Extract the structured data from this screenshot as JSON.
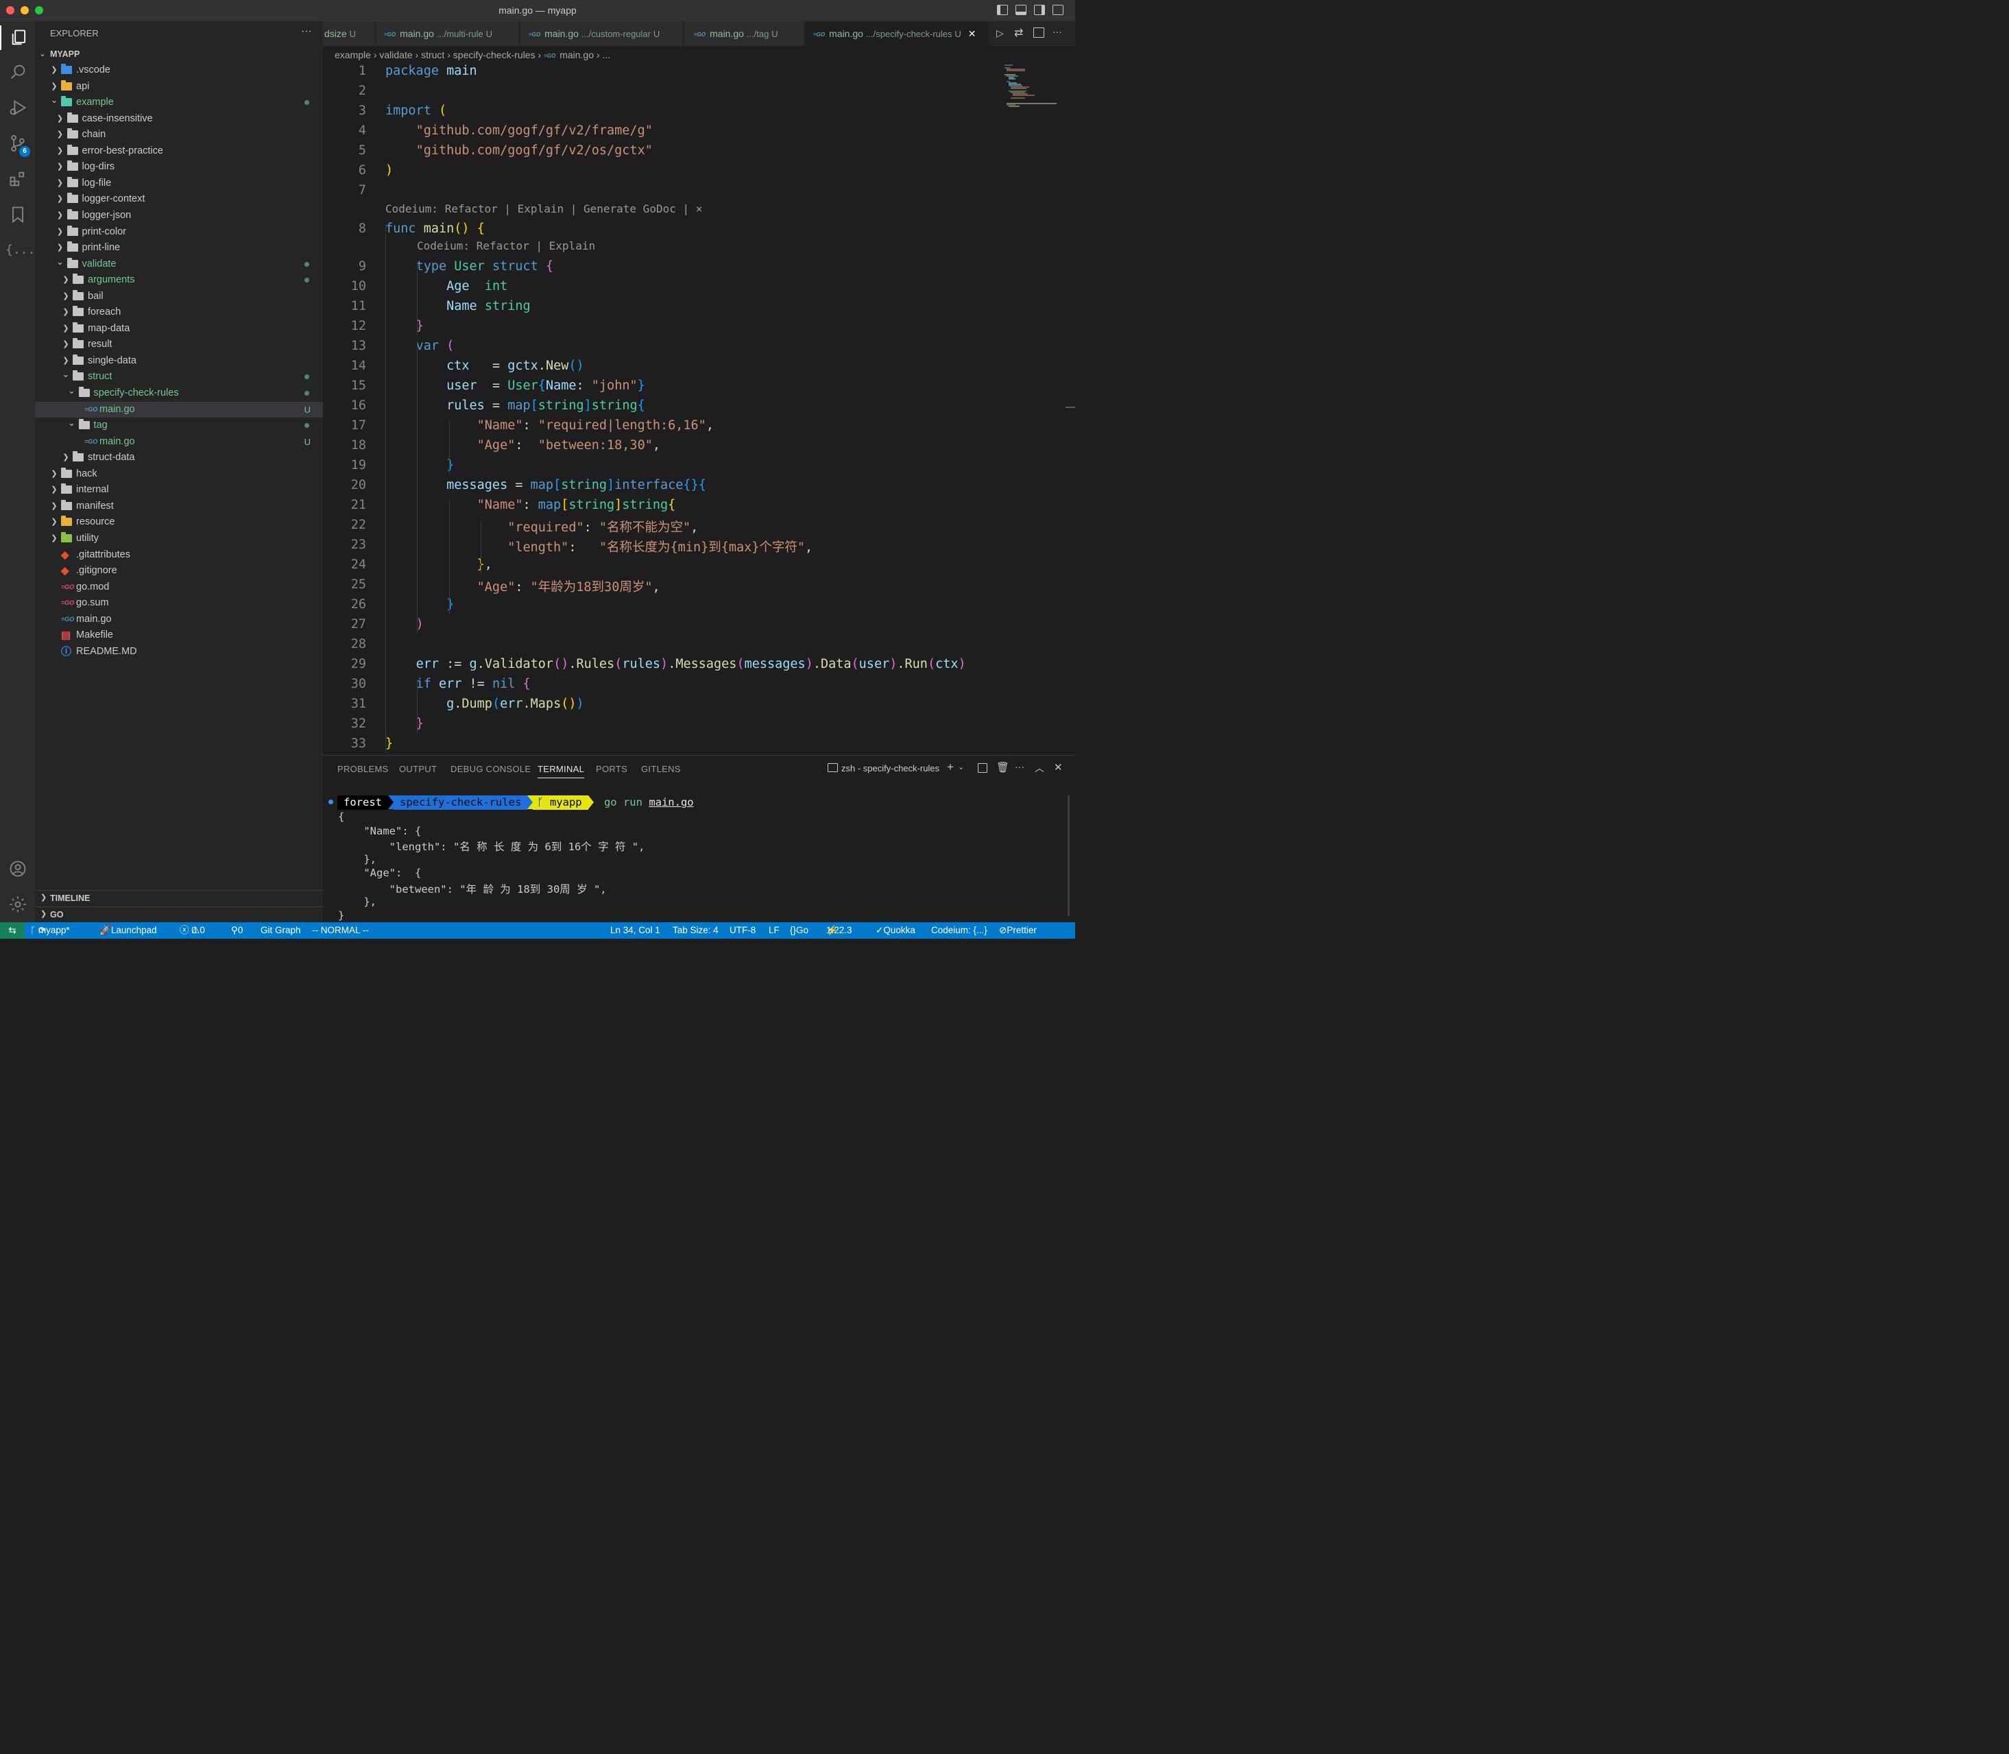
{
  "window": {
    "title": "main.go — myapp"
  },
  "explorer": {
    "header": "EXPLORER",
    "more": "···",
    "root": "MYAPP",
    "items": [
      {
        "label": ".vscode",
        "depth": 0,
        "kind": "folder-vscode",
        "open": false
      },
      {
        "label": "api",
        "depth": 0,
        "kind": "folder-yellow",
        "open": false
      },
      {
        "label": "example",
        "depth": 0,
        "kind": "folder-teal",
        "open": true,
        "dot": true,
        "green": true
      },
      {
        "label": "case-insensitive",
        "depth": 1,
        "kind": "folder",
        "open": false
      },
      {
        "label": "chain",
        "depth": 1,
        "kind": "folder",
        "open": false
      },
      {
        "label": "error-best-practice",
        "depth": 1,
        "kind": "folder",
        "open": false
      },
      {
        "label": "log-dirs",
        "depth": 1,
        "kind": "folder",
        "open": false
      },
      {
        "label": "log-file",
        "depth": 1,
        "kind": "folder",
        "open": false
      },
      {
        "label": "logger-context",
        "depth": 1,
        "kind": "folder",
        "open": false
      },
      {
        "label": "logger-json",
        "depth": 1,
        "kind": "folder",
        "open": false
      },
      {
        "label": "print-color",
        "depth": 1,
        "kind": "folder",
        "open": false
      },
      {
        "label": "print-line",
        "depth": 1,
        "kind": "folder",
        "open": false
      },
      {
        "label": "validate",
        "depth": 1,
        "kind": "folder",
        "open": true,
        "dot": true,
        "green": true
      },
      {
        "label": "arguments",
        "depth": 2,
        "kind": "folder",
        "open": false,
        "dot": true,
        "green": true
      },
      {
        "label": "bail",
        "depth": 2,
        "kind": "folder",
        "open": false
      },
      {
        "label": "foreach",
        "depth": 2,
        "kind": "folder",
        "open": false
      },
      {
        "label": "map-data",
        "depth": 2,
        "kind": "folder",
        "open": false
      },
      {
        "label": "result",
        "depth": 2,
        "kind": "folder",
        "open": false
      },
      {
        "label": "single-data",
        "depth": 2,
        "kind": "folder",
        "open": false
      },
      {
        "label": "struct",
        "depth": 2,
        "kind": "folder",
        "open": true,
        "dot": true,
        "green": true
      },
      {
        "label": "specify-check-rules",
        "depth": 3,
        "kind": "folder",
        "open": true,
        "dot": true,
        "green": true
      },
      {
        "label": "main.go",
        "depth": 4,
        "kind": "go",
        "badge": "U",
        "green": true,
        "selected": true
      },
      {
        "label": "tag",
        "depth": 3,
        "kind": "folder",
        "open": true,
        "dot": true,
        "green": true
      },
      {
        "label": "main.go",
        "depth": 4,
        "kind": "go",
        "badge": "U",
        "green": true
      },
      {
        "label": "struct-data",
        "depth": 2,
        "kind": "folder",
        "open": false
      },
      {
        "label": "hack",
        "depth": 0,
        "kind": "folder",
        "open": false
      },
      {
        "label": "internal",
        "depth": 0,
        "kind": "folder",
        "open": false
      },
      {
        "label": "manifest",
        "depth": 0,
        "kind": "folder",
        "open": false
      },
      {
        "label": "resource",
        "depth": 0,
        "kind": "folder-yellow",
        "open": false
      },
      {
        "label": "utility",
        "depth": 0,
        "kind": "folder-green",
        "open": false
      },
      {
        "label": ".gitattributes",
        "depth": 0,
        "kind": "git"
      },
      {
        "label": ".gitignore",
        "depth": 0,
        "kind": "git"
      },
      {
        "label": "go.mod",
        "depth": 0,
        "kind": "gomod"
      },
      {
        "label": "go.sum",
        "depth": 0,
        "kind": "gomod"
      },
      {
        "label": "main.go",
        "depth": 0,
        "kind": "go"
      },
      {
        "label": "Makefile",
        "depth": 0,
        "kind": "make"
      },
      {
        "label": "README.MD",
        "depth": 0,
        "kind": "info"
      }
    ],
    "timeline": "TIMELINE",
    "go": "GO"
  },
  "tabs": [
    {
      "name": "dsize",
      "path": "",
      "badge": "U"
    },
    {
      "name": "main.go",
      "path": ".../multi-rule",
      "badge": "U"
    },
    {
      "name": "main.go",
      "path": ".../custom-regular",
      "badge": "U"
    },
    {
      "name": "main.go",
      "path": ".../tag",
      "badge": "U"
    },
    {
      "name": "main.go",
      "path": ".../specify-check-rules",
      "badge": "U",
      "active": true
    }
  ],
  "breadcrumb": [
    "example",
    "validate",
    "struct",
    "specify-check-rules",
    "main.go",
    "..."
  ],
  "codelens": {
    "top": "Codeium: Refactor | Explain | Generate GoDoc | ×",
    "inner": "Codeium: Refactor | Explain"
  },
  "code": [
    "package main",
    "",
    "import (",
    "    \"github.com/gogf/gf/v2/frame/g\"",
    "    \"github.com/gogf/gf/v2/os/gctx\"",
    ")",
    "",
    "func main() {",
    "    type User struct {",
    "        Age  int",
    "        Name string",
    "    }",
    "    var (",
    "        ctx   = gctx.New()",
    "        user  = User{Name: \"john\"}",
    "        rules = map[string]string{",
    "            \"Name\": \"required|length:6,16\",",
    "            \"Age\":  \"between:18,30\",",
    "        }",
    "        messages = map[string]interface{}{",
    "            \"Name\": map[string]string{",
    "                \"required\": \"名称不能为空\",",
    "                \"length\":   \"名称长度为{min}到{max}个字符\",",
    "            },",
    "            \"Age\": \"年龄为18到30周岁\",",
    "        }",
    "    )",
    "",
    "    err := g.Validator().Rules(rules).Messages(messages).Data(user).Run(ctx)",
    "    if err != nil {",
    "        g.Dump(err.Maps())",
    "    }",
    "}"
  ],
  "panel": {
    "tabs": [
      "PROBLEMS",
      "OUTPUT",
      "DEBUG CONSOLE",
      "TERMINAL",
      "PORTS",
      "GITLENS"
    ],
    "active_tab": "TERMINAL",
    "terminal_name": "zsh - specify-check-rules",
    "prompt": {
      "user": "forest",
      "dir": "specify-check-rules",
      "branch": "myapp",
      "command": "go run",
      "arg": "main.go"
    },
    "output": [
      "{",
      "    \"Name\": {",
      "        \"length\": \"名 称 长 度 为 6到 16个 字 符 \",",
      "    },",
      "    \"Age\":  {",
      "        \"between\": \"年 龄 为 18到 30周 岁 \",",
      "    },",
      "}"
    ]
  },
  "status": {
    "branch": "myapp*",
    "launchpad": "Launchpad",
    "errors": "0",
    "warnings": "0",
    "ports": "0",
    "git_graph": "Git Graph",
    "vim_mode": "-- NORMAL --",
    "position": "Ln 34, Col 1",
    "tab_size": "Tab Size: 4",
    "encoding": "UTF-8",
    "eol": "LF",
    "language": "Go",
    "go_version": "1.22.3",
    "quokka": "Quokka",
    "codeium": "Codeium: {...}",
    "prettier": "Prettier"
  },
  "colors": {
    "accent": "#007acc",
    "git_untracked": "#73c991"
  }
}
